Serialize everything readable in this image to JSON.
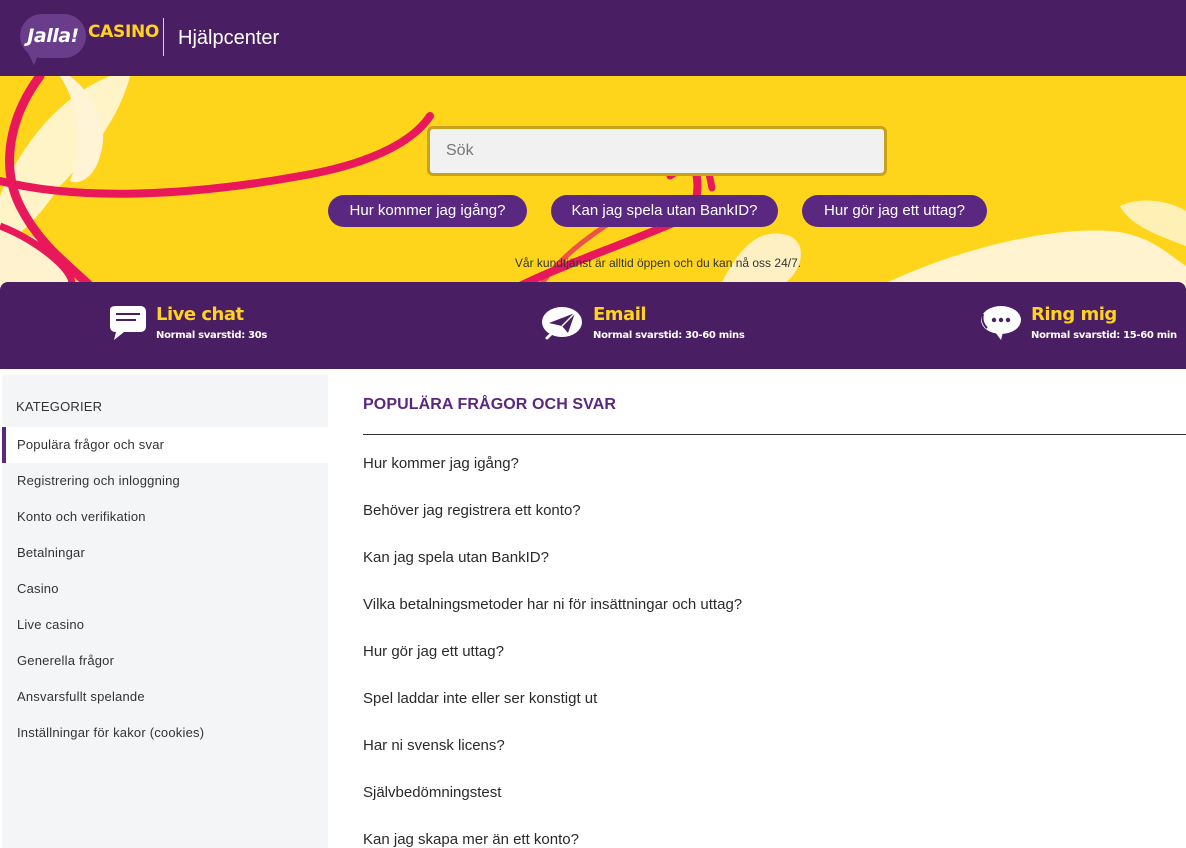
{
  "header": {
    "logo_main": "Jalla!",
    "logo_sub": "CASINO",
    "title": "Hjälpcenter"
  },
  "hero": {
    "search_placeholder": "Sök",
    "quick_links": [
      "Hur kommer jag igång?",
      "Kan jag spela utan BankID?",
      "Hur gör jag ett uttag?"
    ],
    "note": "Vår kundtjänst är alltid öppen och du kan nå oss 24/7."
  },
  "contact": [
    {
      "title": "Live chat",
      "subtitle": "Normal svarstid: 30s",
      "icon": "chat-bubble-icon"
    },
    {
      "title": "Email",
      "subtitle": "Normal svarstid: 30-60 mins",
      "icon": "paper-plane-icon"
    },
    {
      "title": "Ring mig",
      "subtitle": "Normal svarstid: 15-60 min",
      "icon": "phone-bubble-icon"
    }
  ],
  "sidebar": {
    "heading": "KATEGORIER",
    "items": [
      "Populära frågor och svar",
      "Registrering och inloggning",
      "Konto och verifikation",
      "Betalningar",
      "Casino",
      "Live casino",
      "Generella frågor",
      "Ansvarsfullt spelande",
      "Inställningar för kakor (cookies)"
    ]
  },
  "main": {
    "title": "POPULÄRA FRÅGOR OCH SVAR",
    "questions": [
      "Hur kommer jag igång?",
      "Behöver jag registrera ett konto?",
      "Kan jag spela utan BankID?",
      "Vilka betalningsmetoder har ni för insättningar och uttag?",
      "Hur gör jag ett uttag?",
      "Spel laddar inte eller ser konstigt ut",
      "Har ni svensk licens?",
      "Självbedömningstest",
      "Kan jag skapa mer än ett konto?"
    ]
  },
  "colors": {
    "brand_purple": "#4a1e63",
    "button_purple": "#5a2781",
    "hero_yellow": "#ffd51c",
    "accent_yellow": "#ffd21f",
    "deco_pink": "#e8185a"
  }
}
